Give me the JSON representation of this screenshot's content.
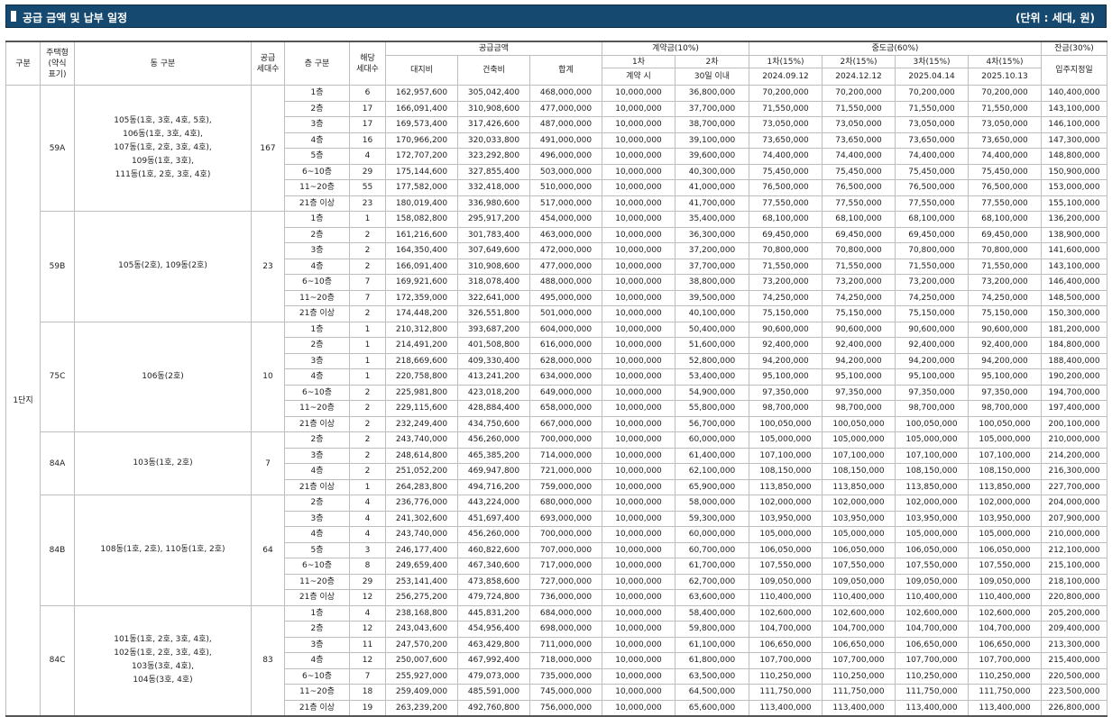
{
  "title": "공급 금액 및 납부 일정",
  "unit": "(단위 : 세대, 원)",
  "headers": {
    "gubun": "구분",
    "type_line1": "주택형",
    "type_line2": "(약식",
    "type_line3": "표기)",
    "dong": "동 구분",
    "supply_line1": "공급",
    "supply_line2": "세대수",
    "floor": "층 구분",
    "applicable_line1": "해당",
    "applicable_line2": "세대수",
    "supply_price": "공급금액",
    "land": "대지비",
    "building": "건축비",
    "total": "합계",
    "contract": "계약금(10%)",
    "c1": "1차",
    "c2": "2차",
    "c1_when": "계약 시",
    "c2_when": "30일 이내",
    "middle": "중도금(60%)",
    "m1": "1차(15%)",
    "m2": "2차(15%)",
    "m3": "3차(15%)",
    "m4": "4차(15%)",
    "m1_date": "2024.09.12",
    "m2_date": "2024.12.12",
    "m3_date": "2025.04.14",
    "m4_date": "2025.10.13",
    "balance": "잔금(30%)",
    "balance_when": "입주지정일"
  },
  "complex": "1단지",
  "groups": [
    {
      "type": "59A",
      "dong": [
        "105동(1호, 3호, 4호, 5호),",
        "106동(1호, 3호, 4호),",
        "107동(1호, 2호, 3호, 4호),",
        "109동(1호, 3호),",
        "111동(1호, 2호, 3호, 4호)"
      ],
      "supply": "167",
      "rows": [
        [
          "1층",
          "6",
          "162,957,600",
          "305,042,400",
          "468,000,000",
          "10,000,000",
          "36,800,000",
          "70,200,000",
          "70,200,000",
          "70,200,000",
          "70,200,000",
          "140,400,000"
        ],
        [
          "2층",
          "17",
          "166,091,400",
          "310,908,600",
          "477,000,000",
          "10,000,000",
          "37,700,000",
          "71,550,000",
          "71,550,000",
          "71,550,000",
          "71,550,000",
          "143,100,000"
        ],
        [
          "3층",
          "17",
          "169,573,400",
          "317,426,600",
          "487,000,000",
          "10,000,000",
          "38,700,000",
          "73,050,000",
          "73,050,000",
          "73,050,000",
          "73,050,000",
          "146,100,000"
        ],
        [
          "4층",
          "16",
          "170,966,200",
          "320,033,800",
          "491,000,000",
          "10,000,000",
          "39,100,000",
          "73,650,000",
          "73,650,000",
          "73,650,000",
          "73,650,000",
          "147,300,000"
        ],
        [
          "5층",
          "4",
          "172,707,200",
          "323,292,800",
          "496,000,000",
          "10,000,000",
          "39,600,000",
          "74,400,000",
          "74,400,000",
          "74,400,000",
          "74,400,000",
          "148,800,000"
        ],
        [
          "6~10층",
          "29",
          "175,144,600",
          "327,855,400",
          "503,000,000",
          "10,000,000",
          "40,300,000",
          "75,450,000",
          "75,450,000",
          "75,450,000",
          "75,450,000",
          "150,900,000"
        ],
        [
          "11~20층",
          "55",
          "177,582,000",
          "332,418,000",
          "510,000,000",
          "10,000,000",
          "41,000,000",
          "76,500,000",
          "76,500,000",
          "76,500,000",
          "76,500,000",
          "153,000,000"
        ],
        [
          "21층 이상",
          "23",
          "180,019,400",
          "336,980,600",
          "517,000,000",
          "10,000,000",
          "41,700,000",
          "77,550,000",
          "77,550,000",
          "77,550,000",
          "77,550,000",
          "155,100,000"
        ]
      ]
    },
    {
      "type": "59B",
      "dong": [
        "105동(2호), 109동(2호)"
      ],
      "supply": "23",
      "rows": [
        [
          "1층",
          "1",
          "158,082,800",
          "295,917,200",
          "454,000,000",
          "10,000,000",
          "35,400,000",
          "68,100,000",
          "68,100,000",
          "68,100,000",
          "68,100,000",
          "136,200,000"
        ],
        [
          "2층",
          "2",
          "161,216,600",
          "301,783,400",
          "463,000,000",
          "10,000,000",
          "36,300,000",
          "69,450,000",
          "69,450,000",
          "69,450,000",
          "69,450,000",
          "138,900,000"
        ],
        [
          "3층",
          "2",
          "164,350,400",
          "307,649,600",
          "472,000,000",
          "10,000,000",
          "37,200,000",
          "70,800,000",
          "70,800,000",
          "70,800,000",
          "70,800,000",
          "141,600,000"
        ],
        [
          "4층",
          "2",
          "166,091,400",
          "310,908,600",
          "477,000,000",
          "10,000,000",
          "37,700,000",
          "71,550,000",
          "71,550,000",
          "71,550,000",
          "71,550,000",
          "143,100,000"
        ],
        [
          "6~10층",
          "7",
          "169,921,600",
          "318,078,400",
          "488,000,000",
          "10,000,000",
          "38,800,000",
          "73,200,000",
          "73,200,000",
          "73,200,000",
          "73,200,000",
          "146,400,000"
        ],
        [
          "11~20층",
          "7",
          "172,359,000",
          "322,641,000",
          "495,000,000",
          "10,000,000",
          "39,500,000",
          "74,250,000",
          "74,250,000",
          "74,250,000",
          "74,250,000",
          "148,500,000"
        ],
        [
          "21층 이상",
          "2",
          "174,448,200",
          "326,551,800",
          "501,000,000",
          "10,000,000",
          "40,100,000",
          "75,150,000",
          "75,150,000",
          "75,150,000",
          "75,150,000",
          "150,300,000"
        ]
      ]
    },
    {
      "type": "75C",
      "dong": [
        "106동(2호)"
      ],
      "supply": "10",
      "rows": [
        [
          "1층",
          "1",
          "210,312,800",
          "393,687,200",
          "604,000,000",
          "10,000,000",
          "50,400,000",
          "90,600,000",
          "90,600,000",
          "90,600,000",
          "90,600,000",
          "181,200,000"
        ],
        [
          "2층",
          "1",
          "214,491,200",
          "401,508,800",
          "616,000,000",
          "10,000,000",
          "51,600,000",
          "92,400,000",
          "92,400,000",
          "92,400,000",
          "92,400,000",
          "184,800,000"
        ],
        [
          "3층",
          "1",
          "218,669,600",
          "409,330,400",
          "628,000,000",
          "10,000,000",
          "52,800,000",
          "94,200,000",
          "94,200,000",
          "94,200,000",
          "94,200,000",
          "188,400,000"
        ],
        [
          "4층",
          "1",
          "220,758,800",
          "413,241,200",
          "634,000,000",
          "10,000,000",
          "53,400,000",
          "95,100,000",
          "95,100,000",
          "95,100,000",
          "95,100,000",
          "190,200,000"
        ],
        [
          "6~10층",
          "2",
          "225,981,800",
          "423,018,200",
          "649,000,000",
          "10,000,000",
          "54,900,000",
          "97,350,000",
          "97,350,000",
          "97,350,000",
          "97,350,000",
          "194,700,000"
        ],
        [
          "11~20층",
          "2",
          "229,115,600",
          "428,884,400",
          "658,000,000",
          "10,000,000",
          "55,800,000",
          "98,700,000",
          "98,700,000",
          "98,700,000",
          "98,700,000",
          "197,400,000"
        ],
        [
          "21층 이상",
          "2",
          "232,249,400",
          "434,750,600",
          "667,000,000",
          "10,000,000",
          "56,700,000",
          "100,050,000",
          "100,050,000",
          "100,050,000",
          "100,050,000",
          "200,100,000"
        ]
      ]
    },
    {
      "type": "84A",
      "dong": [
        "103동(1호, 2호)"
      ],
      "supply": "7",
      "rows": [
        [
          "2층",
          "2",
          "243,740,000",
          "456,260,000",
          "700,000,000",
          "10,000,000",
          "60,000,000",
          "105,000,000",
          "105,000,000",
          "105,000,000",
          "105,000,000",
          "210,000,000"
        ],
        [
          "3층",
          "2",
          "248,614,800",
          "465,385,200",
          "714,000,000",
          "10,000,000",
          "61,400,000",
          "107,100,000",
          "107,100,000",
          "107,100,000",
          "107,100,000",
          "214,200,000"
        ],
        [
          "4층",
          "2",
          "251,052,200",
          "469,947,800",
          "721,000,000",
          "10,000,000",
          "62,100,000",
          "108,150,000",
          "108,150,000",
          "108,150,000",
          "108,150,000",
          "216,300,000"
        ],
        [
          "21층 이상",
          "1",
          "264,283,800",
          "494,716,200",
          "759,000,000",
          "10,000,000",
          "65,900,000",
          "113,850,000",
          "113,850,000",
          "113,850,000",
          "113,850,000",
          "227,700,000"
        ]
      ]
    },
    {
      "type": "84B",
      "dong": [
        "108동(1호, 2호), 110동(1호, 2호)"
      ],
      "supply": "64",
      "rows": [
        [
          "2층",
          "4",
          "236,776,000",
          "443,224,000",
          "680,000,000",
          "10,000,000",
          "58,000,000",
          "102,000,000",
          "102,000,000",
          "102,000,000",
          "102,000,000",
          "204,000,000"
        ],
        [
          "3층",
          "4",
          "241,302,600",
          "451,697,400",
          "693,000,000",
          "10,000,000",
          "59,300,000",
          "103,950,000",
          "103,950,000",
          "103,950,000",
          "103,950,000",
          "207,900,000"
        ],
        [
          "4층",
          "4",
          "243,740,000",
          "456,260,000",
          "700,000,000",
          "10,000,000",
          "60,000,000",
          "105,000,000",
          "105,000,000",
          "105,000,000",
          "105,000,000",
          "210,000,000"
        ],
        [
          "5층",
          "3",
          "246,177,400",
          "460,822,600",
          "707,000,000",
          "10,000,000",
          "60,700,000",
          "106,050,000",
          "106,050,000",
          "106,050,000",
          "106,050,000",
          "212,100,000"
        ],
        [
          "6~10층",
          "8",
          "249,659,400",
          "467,340,600",
          "717,000,000",
          "10,000,000",
          "61,700,000",
          "107,550,000",
          "107,550,000",
          "107,550,000",
          "107,550,000",
          "215,100,000"
        ],
        [
          "11~20층",
          "29",
          "253,141,400",
          "473,858,600",
          "727,000,000",
          "10,000,000",
          "62,700,000",
          "109,050,000",
          "109,050,000",
          "109,050,000",
          "109,050,000",
          "218,100,000"
        ],
        [
          "21층 이상",
          "12",
          "256,275,200",
          "479,724,800",
          "736,000,000",
          "10,000,000",
          "63,600,000",
          "110,400,000",
          "110,400,000",
          "110,400,000",
          "110,400,000",
          "220,800,000"
        ]
      ]
    },
    {
      "type": "84C",
      "dong": [
        "101동(1호, 2호, 3호, 4호),",
        "102동(1호, 2호, 3호, 4호),",
        "103동(3호, 4호),",
        "104동(3호, 4호)"
      ],
      "supply": "83",
      "rows": [
        [
          "1층",
          "4",
          "238,168,800",
          "445,831,200",
          "684,000,000",
          "10,000,000",
          "58,400,000",
          "102,600,000",
          "102,600,000",
          "102,600,000",
          "102,600,000",
          "205,200,000"
        ],
        [
          "2층",
          "12",
          "243,043,600",
          "454,956,400",
          "698,000,000",
          "10,000,000",
          "59,800,000",
          "104,700,000",
          "104,700,000",
          "104,700,000",
          "104,700,000",
          "209,400,000"
        ],
        [
          "3층",
          "11",
          "247,570,200",
          "463,429,800",
          "711,000,000",
          "10,000,000",
          "61,100,000",
          "106,650,000",
          "106,650,000",
          "106,650,000",
          "106,650,000",
          "213,300,000"
        ],
        [
          "4층",
          "12",
          "250,007,600",
          "467,992,400",
          "718,000,000",
          "10,000,000",
          "61,800,000",
          "107,700,000",
          "107,700,000",
          "107,700,000",
          "107,700,000",
          "215,400,000"
        ],
        [
          "6~10층",
          "7",
          "255,927,000",
          "479,073,000",
          "735,000,000",
          "10,000,000",
          "63,500,000",
          "110,250,000",
          "110,250,000",
          "110,250,000",
          "110,250,000",
          "220,500,000"
        ],
        [
          "11~20층",
          "18",
          "259,409,000",
          "485,591,000",
          "745,000,000",
          "10,000,000",
          "64,500,000",
          "111,750,000",
          "111,750,000",
          "111,750,000",
          "111,750,000",
          "223,500,000"
        ],
        [
          "21층 이상",
          "19",
          "263,239,200",
          "492,760,800",
          "756,000,000",
          "10,000,000",
          "65,600,000",
          "113,400,000",
          "113,400,000",
          "113,400,000",
          "113,400,000",
          "226,800,000"
        ]
      ]
    }
  ]
}
